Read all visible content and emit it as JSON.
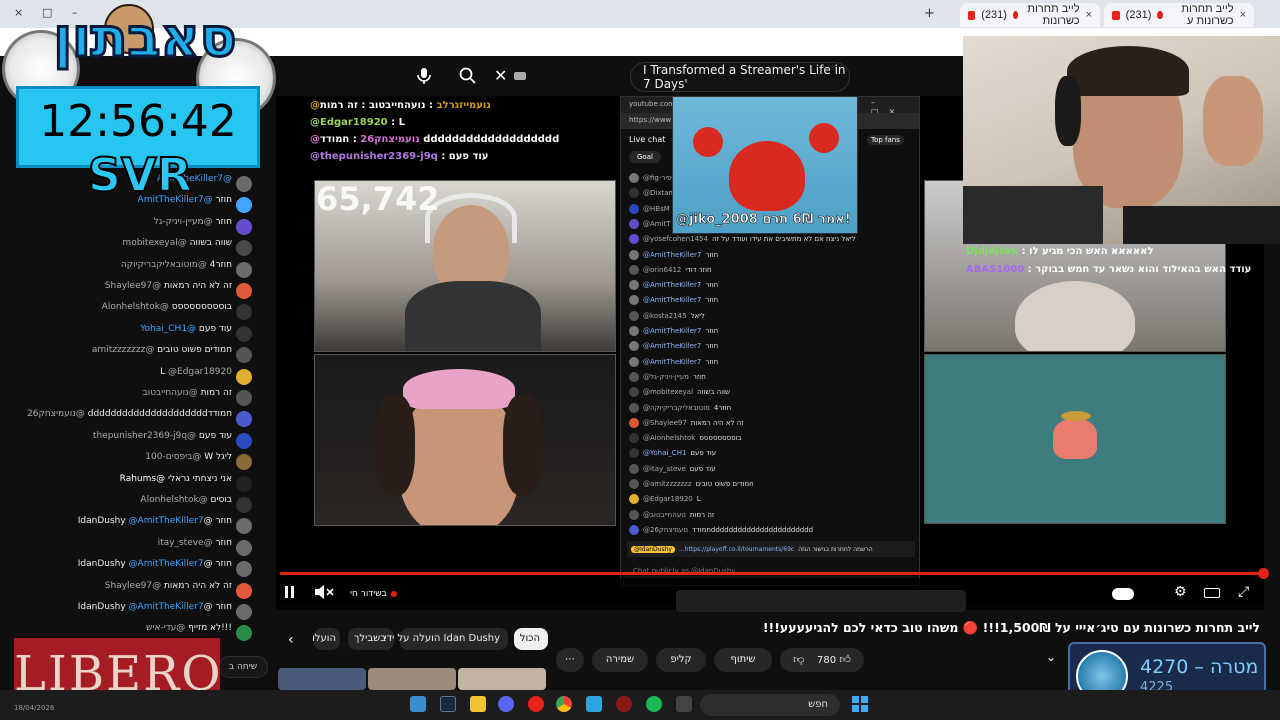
{
  "browser": {
    "tabs": [
      {
        "count": "(231)",
        "title": "לייב תחרות כשרונות"
      },
      {
        "count": "(231)",
        "title": "לייב תחרות כשרונות ע"
      }
    ],
    "window_controls": [
      "–",
      "□",
      "×"
    ]
  },
  "search": {
    "query": "I Transformed a Streamer's Life in 7 Days'"
  },
  "overlay": {
    "title_art": "סאבתון",
    "clock": "12:56:42",
    "tag": "SVR",
    "viewers": "65,742",
    "sponge_caption": "@jiko_2008 אמר 6₪ תרם!"
  },
  "overlay_chat": [
    {
      "user": "@נועמייזגרלב",
      "msg": ": נועהחייבטוב : זה רמות",
      "color": "#d4a017"
    },
    {
      "user": "@Edgar18920",
      "msg": ": L",
      "color": "#9bd15c"
    },
    {
      "user": "@נועמיצחק26",
      "msg": ": חמודד ddddddddddddddddddd",
      "color": "#d96fd6"
    },
    {
      "user": "@thepunisher2369-j9q",
      "msg": ": עוד פעם",
      "color": "#b07be0"
    }
  ],
  "overlay_chat_right": [
    {
      "user": "Djdjdjskk",
      "msg": ": לאאאאא האש הכי מגיע לו",
      "color": "#7be35c"
    },
    {
      "user": "ABAS1000",
      "msg": ": עודד האש בהאילוד והוא נשאר עד חמש בבוקר",
      "color": "#a66cf0"
    }
  ],
  "left_chat": [
    {
      "user": "@AmitTheKiller7",
      "msg": "",
      "color": "#3ea6ff"
    },
    {
      "user": "@AmitTheKiller7",
      "msg": "חוזר",
      "color": "#3ea6ff"
    },
    {
      "user": "@מעיין-ויניק-גל",
      "msg": "חוזר",
      "color": "#aaa"
    },
    {
      "user": "@mobitexeyal",
      "msg": "שווה בשווה",
      "color": "#aaa"
    },
    {
      "user": "@מוטובאליקבריקיוקה",
      "msg": "חוזר4",
      "color": "#aaa"
    },
    {
      "user": "@Shaylee97",
      "msg": "זה לא היה רמאות",
      "color": "#aaa"
    },
    {
      "user": "@Alonhelshtok",
      "msg": "בוססססססססס",
      "color": "#aaa"
    },
    {
      "user": "@Yohai_CH1",
      "msg": "עוד פעם",
      "color": "#3ea6ff"
    },
    {
      "user": "@amitzzzzzzz",
      "msg": "חמודים פשוט טובים",
      "color": "#aaa"
    },
    {
      "user": "@Edgar18920",
      "msg": "L",
      "color": "#aaa"
    },
    {
      "user": "@נועהחייבטוב",
      "msg": "זה רמות",
      "color": "#aaa"
    },
    {
      "user": "@נועמיצחק26",
      "msg": "חמודדddddddddddddddddddddd",
      "color": "#aaa"
    },
    {
      "user": "@thepunisher2369-j9q",
      "msg": "עוד פעם",
      "color": "#aaa"
    },
    {
      "user": "@ביפסים-100",
      "msg": "ליגל W",
      "color": "#aaa"
    },
    {
      "user": "@Rahums",
      "msg": "אני ניצחתי גראלי",
      "color": "#fff"
    },
    {
      "user": "@Alonhelshtok",
      "msg": "בוסים",
      "color": "#aaa"
    },
    {
      "user": "@AmitTheKiller7",
      "msg": "חוזר @IdanDushy",
      "color": "#3ea6ff"
    },
    {
      "user": "@itay_steve",
      "msg": "חוזר",
      "color": "#aaa"
    },
    {
      "user": "@AmitTheKiller7",
      "msg": "חוזר @IdanDushy",
      "color": "#3ea6ff"
    },
    {
      "user": "@Shaylee97",
      "msg": "זה לא היה רמאות",
      "color": "#aaa"
    },
    {
      "user": "@AmitTheKiller7",
      "msg": "חוזר @IdanDushy",
      "color": "#3ea6ff"
    },
    {
      "user": "@עדי-איש",
      "msg": "!!!לא מזייף",
      "color": "#aaa"
    }
  ],
  "left_chat_button": "שיחה ב",
  "embedded_chat": {
    "url": "youtube.com/live_chat",
    "address": "https://www",
    "header": "Live chat",
    "top_fans": "Top fans",
    "goal": "Goal",
    "rows": [
      {
        "user": "@fig-זיפיר",
        "msg": ""
      },
      {
        "user": "@Dixtam",
        "msg": ""
      },
      {
        "user": "@HBsM",
        "msg": ""
      },
      {
        "user": "@AmitT",
        "msg": ""
      },
      {
        "user": "@yosefcohen1454",
        "msg": "ליאל ניצח אם לא מתשיבים את עידו ועודד על זה"
      },
      {
        "user": "@AmitTheKiller7",
        "msg": "חוזר"
      },
      {
        "user": "@orin6412",
        "msg": "חוזר דודי"
      },
      {
        "user": "@AmitTheKiller7",
        "msg": "חוזר"
      },
      {
        "user": "@AmitTheKiller7",
        "msg": "חוזר"
      },
      {
        "user": "@kosta2145",
        "msg": "ליאל"
      },
      {
        "user": "@AmitTheKiller7",
        "msg": "חוזר"
      },
      {
        "user": "@AmitTheKiller7",
        "msg": "חוזר"
      },
      {
        "user": "@AmitTheKiller7",
        "msg": "חוזר"
      },
      {
        "user": "@מעיין-ויניק-גל",
        "msg": "חוזר"
      },
      {
        "user": "@mobitexeyal",
        "msg": "שווה בשווה"
      },
      {
        "user": "@מוטובאליקבריקיוקה",
        "msg": "חוזר4"
      },
      {
        "user": "@Shaylee97",
        "msg": "זה לא היה רמאות"
      },
      {
        "user": "@Alonhelshtok",
        "msg": "בוסססססססס"
      },
      {
        "user": "@Yohai_CH1",
        "msg": "עוד פעם"
      },
      {
        "user": "@itay_steve",
        "msg": "עוד פעם"
      },
      {
        "user": "@amitzzzzzzz",
        "msg": "חמודים פשוט טובים"
      },
      {
        "user": "@Edgar18920",
        "msg": "L"
      },
      {
        "user": "@נועהחייבטוב",
        "msg": "זה רמות"
      },
      {
        "user": "@נועמיצחק26",
        "msg": "חמודדddddddddddddddddddddddd"
      }
    ],
    "pinned_user": "@IdanDushy",
    "pinned_msg": "...https://playoff.co.il/tournaments/69c",
    "pinned_prefix": "הרשמה לתחרות בגישור הגזה",
    "input_placeholder": "Chat publicly as @IdanDushy..."
  },
  "player": {
    "live_label": "בשידור חי",
    "play_icon": "pause-icon",
    "mute_icon": "mute-icon"
  },
  "video": {
    "title": "לייב תחרות כשרונות עם טיג׳אייי על 1,500₪!!! 🔴 משהו טוב כדאי לכם להגיעעעע!!!",
    "chips": [
      {
        "label": "הכול",
        "selected": true
      },
      {
        "label": "Idan Dushy הועלה על ידי",
        "selected": false
      },
      {
        "label": "בשבילך",
        "selected": false
      },
      {
        "label": "הועלו",
        "selected": false
      }
    ],
    "likes": "780",
    "share": "שיתוף",
    "clip": "קליפ",
    "save": "שמירה",
    "more": "⋯"
  },
  "goal_widget": {
    "label": "מטרה",
    "target": "4270",
    "current": "4225",
    "sep": "–"
  },
  "sponsor": {
    "text": "LIBERO"
  },
  "taskbar": {
    "search": "חפש",
    "date": "18/04/2026"
  }
}
